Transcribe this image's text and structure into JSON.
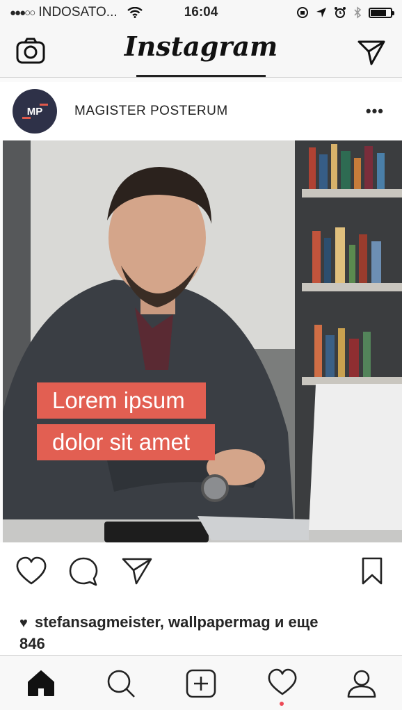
{
  "status_bar": {
    "carrier": "INDOSATO...",
    "time": "16:04"
  },
  "header": {
    "app_title": "Instagram"
  },
  "post": {
    "author": {
      "avatar_initials": "MP",
      "username": "MAGISTER POSTERUM"
    },
    "more_label": "•••",
    "image_caption_line1": "Lorem ipsum",
    "image_caption_line2": "dolor sit amet",
    "likes": {
      "text": "stefansagmeister, wallpapermag и еще",
      "count": "846"
    }
  },
  "colors": {
    "accent": "#e25f52",
    "avatar_bg": "#2e3148",
    "notification_dot": "#ed4956"
  },
  "icons": {
    "header_left": "camera-icon",
    "header_right": "direct-message-icon",
    "actions": [
      "heart-icon",
      "comment-icon",
      "share-icon",
      "bookmark-icon"
    ],
    "bottom_nav": [
      "home-icon",
      "search-icon",
      "add-post-icon",
      "activity-heart-icon",
      "profile-icon"
    ]
  }
}
